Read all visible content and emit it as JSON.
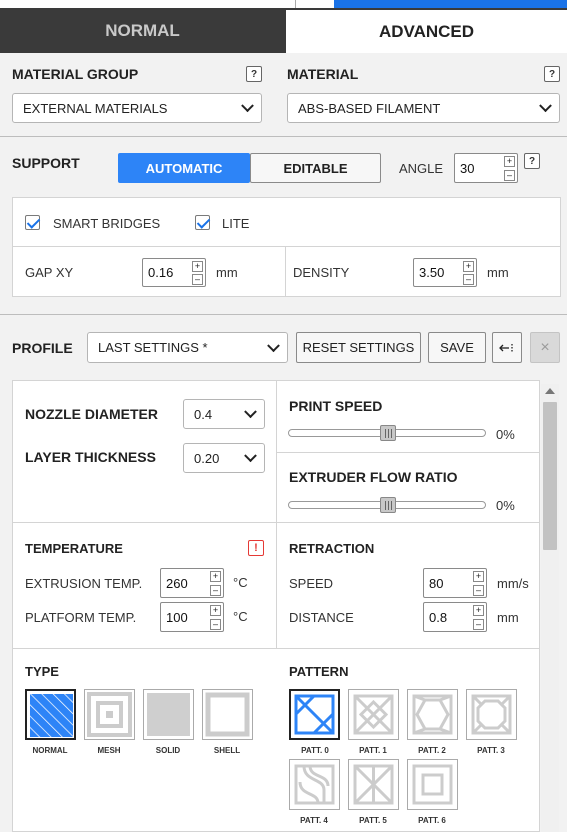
{
  "tabs": {
    "normal": "NORMAL",
    "advanced": "ADVANCED"
  },
  "material_group": {
    "label": "MATERIAL GROUP",
    "help": "?",
    "value": "EXTERNAL MATERIALS"
  },
  "material": {
    "label": "MATERIAL",
    "help": "?",
    "value": "ABS-BASED FILAMENT"
  },
  "support": {
    "label": "SUPPORT",
    "automatic": "AUTOMATIC",
    "editable": "EDITABLE",
    "angle_label": "ANGLE",
    "angle_value": "30",
    "help": "?",
    "smart_bridges": "SMART BRIDGES",
    "lite": "LITE",
    "gap_xy_label": "GAP XY",
    "gap_xy_value": "0.16",
    "gap_xy_unit": "mm",
    "density_label": "DENSITY",
    "density_value": "3.50",
    "density_unit": "mm"
  },
  "profile": {
    "label": "PROFILE",
    "value": "LAST SETTINGS *",
    "reset": "RESET SETTINGS",
    "save": "SAVE",
    "close": "×"
  },
  "nozzle": {
    "label": "NOZZLE DIAMETER",
    "value": "0.4"
  },
  "layer": {
    "label": "LAYER THICKNESS",
    "value": "0.20"
  },
  "print_speed": {
    "label": "PRINT SPEED",
    "value": "0%"
  },
  "flow_ratio": {
    "label": "EXTRUDER FLOW RATIO",
    "value": "0%"
  },
  "temperature": {
    "label": "TEMPERATURE",
    "alert": "!",
    "extrusion_label": "EXTRUSION TEMP.",
    "extrusion_value": "260",
    "platform_label": "PLATFORM TEMP.",
    "platform_value": "100",
    "unit": "°C"
  },
  "retraction": {
    "label": "RETRACTION",
    "speed_label": "SPEED",
    "speed_value": "80",
    "speed_unit": "mm/s",
    "distance_label": "DISTANCE",
    "distance_value": "0.8",
    "distance_unit": "mm"
  },
  "type": {
    "label": "TYPE",
    "items": [
      "NORMAL",
      "MESH",
      "SOLID",
      "SHELL"
    ]
  },
  "pattern": {
    "label": "PATTERN",
    "items": [
      "PATT. 0",
      "PATT. 1",
      "PATT. 2",
      "PATT. 3",
      "PATT. 4",
      "PATT. 5",
      "PATT. 6"
    ]
  },
  "colors": {
    "accent": "#2d84f7",
    "alert": "#e53935",
    "tab_bar": "#3a3a3a"
  }
}
